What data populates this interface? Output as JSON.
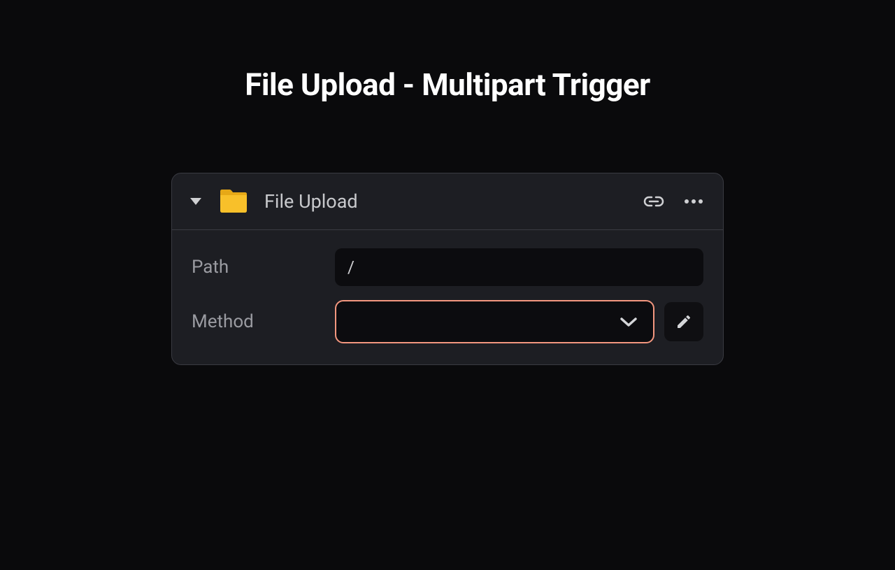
{
  "page": {
    "title": "File Upload - Multipart Trigger"
  },
  "card": {
    "title": "File Upload",
    "fields": {
      "path": {
        "label": "Path",
        "value": "/"
      },
      "method": {
        "label": "Method",
        "value": ""
      }
    }
  },
  "colors": {
    "folder": "#f8c02a",
    "highlight_border": "#f3977f"
  }
}
